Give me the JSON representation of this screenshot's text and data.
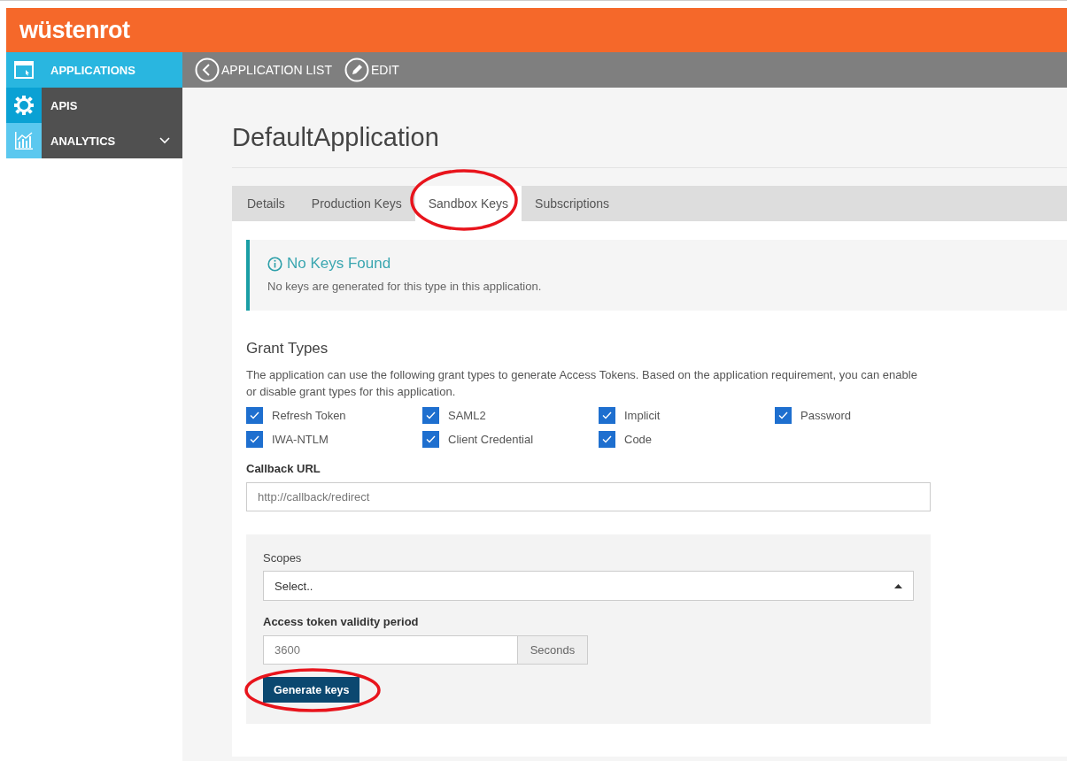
{
  "header": {
    "logo": "wüstenrot"
  },
  "sidebar": {
    "items": [
      {
        "label": "APPLICATIONS",
        "selected": true,
        "kind": "window"
      },
      {
        "label": "APIS",
        "selected": false,
        "kind": "gear"
      },
      {
        "label": "ANALYTICS",
        "selected": false,
        "kind": "chart",
        "expandable": true
      }
    ]
  },
  "toolbar": {
    "items": [
      {
        "label": "APPLICATION LIST",
        "kind": "back"
      },
      {
        "label": "EDIT",
        "kind": "edit"
      }
    ]
  },
  "page_title": "DefaultApplication",
  "tabs": [
    {
      "label": "Details",
      "selected": false,
      "circled": false
    },
    {
      "label": "Production Keys",
      "selected": false,
      "circled": false
    },
    {
      "label": "Sandbox Keys",
      "selected": true,
      "circled": true
    },
    {
      "label": "Subscriptions",
      "selected": false,
      "circled": false
    }
  ],
  "notice": {
    "title": "No Keys Found",
    "text": "No keys are generated for this type in this application."
  },
  "grant_types": {
    "title": "Grant Types",
    "description": "The application can use the following grant types to generate Access Tokens. Based on the application requirement, you can enable or disable grant types for this application.",
    "options": [
      {
        "label": "Refresh Token",
        "checked": true
      },
      {
        "label": "SAML2",
        "checked": true
      },
      {
        "label": "Implicit",
        "checked": true
      },
      {
        "label": "Password",
        "checked": true
      },
      {
        "label": "IWA-NTLM",
        "checked": true
      },
      {
        "label": "Client Credential",
        "checked": true
      },
      {
        "label": "Code",
        "checked": true
      }
    ]
  },
  "callback_url": {
    "label": "Callback URL",
    "placeholder": "http://callback/redirect"
  },
  "scopes": {
    "label": "Scopes",
    "placeholder": "Select.."
  },
  "validity": {
    "label": "Access token validity period",
    "placeholder": "3600",
    "unit": "Seconds"
  },
  "generate_button": {
    "label": "Generate keys",
    "circled": true
  }
}
